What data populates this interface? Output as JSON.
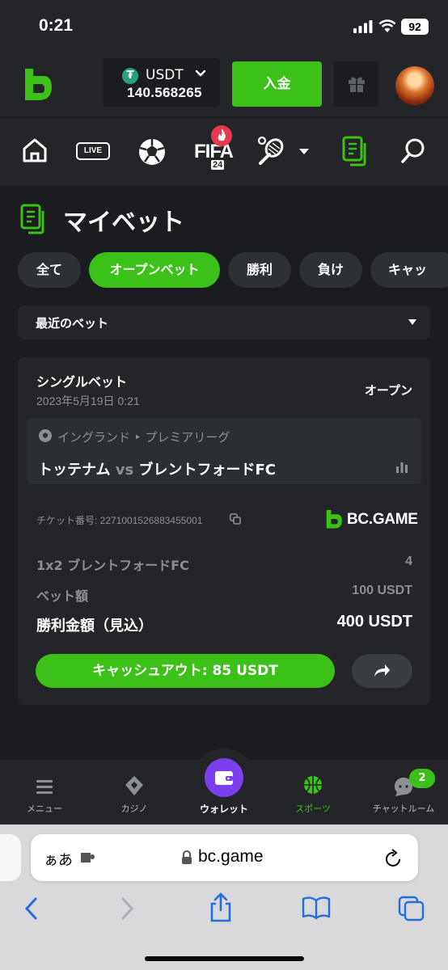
{
  "status": {
    "time": "0:21",
    "battery": "92"
  },
  "header": {
    "currency": "USDT",
    "currency_icon": "₮",
    "balance": "140.568265",
    "deposit_label": "入金"
  },
  "nav_icons": [
    "home-icon",
    "live-icon",
    "soccer-icon",
    "fifa24-icon",
    "tennis-icon",
    "dropdown-icon",
    "mybets-icon",
    "search-icon"
  ],
  "nav": {
    "live_label": "LIVE",
    "fifa_label": "FIFA",
    "fifa_year": "24"
  },
  "page": {
    "title": "マイベット"
  },
  "tabs": [
    {
      "label": "全て",
      "active": false
    },
    {
      "label": "オープンベット",
      "active": true
    },
    {
      "label": "勝利",
      "active": false
    },
    {
      "label": "負け",
      "active": false
    },
    {
      "label": "キャッ",
      "active": false
    }
  ],
  "filter": {
    "selected": "最近のベット"
  },
  "bet": {
    "type": "シングルベット",
    "date": "2023年5月19日 0:21",
    "status": "オープン",
    "league": "イングランド ‣ プレミアリーグ",
    "home": "トッテナム",
    "vs": "vs",
    "away": "ブレントフォードFC",
    "ticket": "チケット番号: 2271001526883455001",
    "brand": "BC.GAME",
    "selection_label": "1x2 ブレントフォードFC",
    "odds": "4",
    "stake_label": "ベット額",
    "stake": "100 USDT",
    "payout_label": "勝利金額（見込）",
    "payout": "400 USDT",
    "cashout_label": "キャッシュアウト: 85 USDT"
  },
  "bottom_nav": [
    {
      "label": "メニュー",
      "icon": "menu-icon"
    },
    {
      "label": "カジノ",
      "icon": "casino-icon"
    },
    {
      "label": "ウォレット",
      "icon": "wallet-icon"
    },
    {
      "label": "スポーツ",
      "icon": "sports-icon"
    },
    {
      "label": "チャットルーム",
      "icon": "chat-icon"
    }
  ],
  "chat_badge": "2",
  "browser": {
    "aa": "ぁあ",
    "url": "bc.game"
  },
  "colors": {
    "accent": "#3bc117",
    "wallet": "#7b3ff0",
    "bg": "#1a1c1f",
    "panel": "#232528"
  }
}
